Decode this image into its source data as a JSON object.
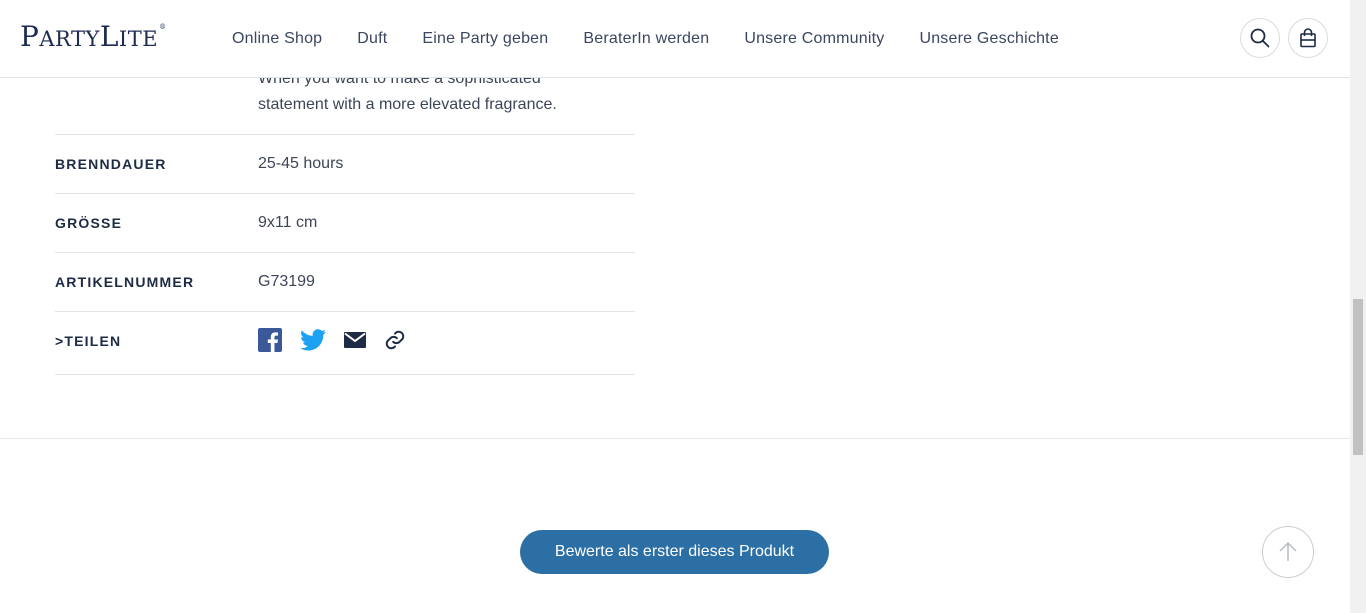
{
  "brand": {
    "logo_first_big": "P",
    "logo_first_small": "ARTY",
    "logo_second_big": "L",
    "logo_second_small": "ITE",
    "logo_mark": "®"
  },
  "nav": {
    "items": [
      {
        "label": "Online Shop"
      },
      {
        "label": "Duft"
      },
      {
        "label": "Eine Party geben"
      },
      {
        "label": "BeraterIn werden"
      },
      {
        "label": "Unsere Community"
      },
      {
        "label": "Unsere Geschichte"
      }
    ],
    "search_icon": "search-icon",
    "cart_icon": "shopping-bag-icon"
  },
  "product": {
    "description_line1": "When you want to make a sophisticated",
    "description_line2": "statement with a more elevated fragrance.",
    "details": [
      {
        "label": "BRENNDAUER",
        "value": "25-45 hours"
      },
      {
        "label": "GRÖSSE",
        "value": "9x11 cm"
      },
      {
        "label": "ARTIKELNUMMER",
        "value": "G73199"
      }
    ],
    "share": {
      "label": ">TEILEN",
      "icons": [
        "facebook-icon",
        "twitter-icon",
        "email-icon",
        "link-icon"
      ]
    }
  },
  "reviews": {
    "button_label": "Bewerte als erster dieses Produkt"
  },
  "colors": {
    "primary": "#2c6fa5",
    "brand_navy": "#1d2b52",
    "twitter": "#1da1f2",
    "facebook": "#3b5998"
  }
}
